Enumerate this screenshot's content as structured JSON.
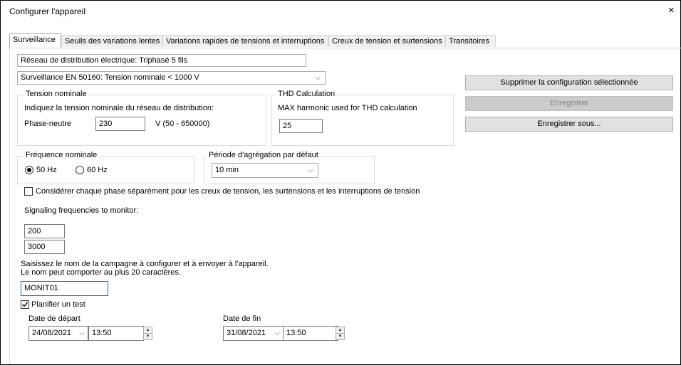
{
  "window": {
    "title": "Configurer l'appareil",
    "close": "×"
  },
  "tabs": [
    {
      "label": "Surveillance"
    },
    {
      "label": "Seuils des variations lentes"
    },
    {
      "label": "Variations rapides de tensions et interruptions"
    },
    {
      "label": "Creux de tension et surtensions"
    },
    {
      "label": "Transitoires"
    }
  ],
  "network": {
    "value": "Réseau de distribution électrique: Triphasé 5 fils"
  },
  "monitoring": {
    "selected": "Surveillance EN 50160: Tension nominale < 1000 V",
    "chevron": "⌵"
  },
  "buttons": {
    "delete": "Supprimer la configuration sélectionnée",
    "save": "Enregistrer",
    "save_as": "Enregistrer sous..."
  },
  "nominal_voltage": {
    "legend": "Tension nominale",
    "hint": "Indiquez la tension nominale du réseau de distribution:",
    "label": "Phase-neutre",
    "value": "230",
    "range": "V (50 - 650000)"
  },
  "thd": {
    "legend": "THD Calculation",
    "hint": "MAX harmonic used for THD calculation",
    "value": "25"
  },
  "frequency": {
    "legend": "Fréquence nominale",
    "opt50": "50 Hz",
    "opt60": "60 Hz",
    "selected": "50 Hz"
  },
  "aggregation": {
    "legend": "Période d'agrégation par défaut",
    "selected": "10 min"
  },
  "per_phase": {
    "label": "Considérer chaque phase séparément pour les creux de tension, les surtensions et les interruptions de tension",
    "checked": false
  },
  "signaling": {
    "label": "Signaling frequencies to monitor:",
    "f1": "200",
    "f2": "3000"
  },
  "campaign": {
    "hint1": "Saisissez le nom de la campagne à configurer et à envoyer à l'appareil.",
    "hint2": "Le nom peut comporter au plus 20 caractères.",
    "value": "MONIT01"
  },
  "schedule": {
    "label": "Planifier un test",
    "checked": true,
    "start_label": "Date de départ",
    "start_date": "24/08/2021",
    "start_time": "13:50",
    "end_label": "Date de fin",
    "end_date": "31/08/2021",
    "end_time": "13:50"
  }
}
